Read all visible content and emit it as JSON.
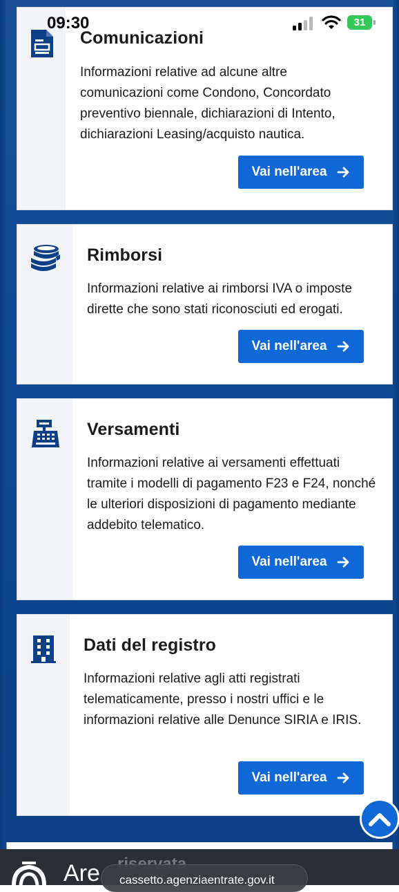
{
  "status_bar": {
    "time": "09:30",
    "battery": "31"
  },
  "cards": [
    {
      "title": "Comunicazioni",
      "description": "Informazioni relative ad alcune altre comunicazioni come Condono, Concordato preventivo biennale, dichiarazioni di Intento, dichiarazioni Leasing/acquisto nautica.",
      "button": "Vai nell'area",
      "icon": "document-icon"
    },
    {
      "title": "Rimborsi",
      "description": "Informazioni relative ai rimborsi IVA o imposte dirette che sono stati riconosciuti ed erogati.",
      "button": "Vai nell'area",
      "icon": "coins-icon"
    },
    {
      "title": "Versamenti",
      "description": "Informazioni relative ai versamenti effettuati tramite i modelli di pagamento F23 e F24, nonché le ulteriori disposizioni di pagamento mediante addebito telematico.",
      "button": "Vai nell'area",
      "icon": "cash-register-icon"
    },
    {
      "title": "Dati del registro",
      "description": "Informazioni relative agli atti registrati telematicamente, presso i nostri uffici e le informazioni relative alle Denunce SIRIA e IRIS.",
      "button": "Vai nell'area",
      "icon": "building-icon"
    }
  ],
  "footer": {
    "brand": "Are",
    "ghost": "riservata",
    "url": "cassetto.agenziaentrate.gov.it"
  },
  "colors": {
    "primary": "#0f68d6",
    "navy": "#0d4a97",
    "icon": "#0b3f86"
  }
}
